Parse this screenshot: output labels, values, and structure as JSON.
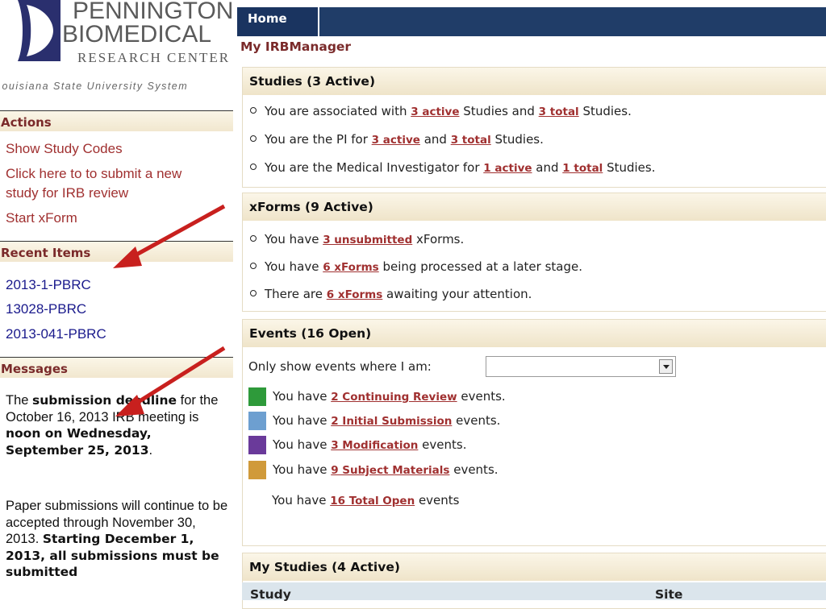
{
  "logo": {
    "line1": "PENNINGTON",
    "line2": "BIOMEDICAL",
    "line3": "RESEARCH CENTER",
    "line4": "Louisiana State University System"
  },
  "sidebar": {
    "actions_title": "Actions",
    "actions": [
      "Show Study Codes",
      "Click here to to submit a new",
      "study for IRB review",
      "Start xForm"
    ],
    "recent_title": "Recent Items",
    "recent": [
      "2013-1-PBRC",
      "13028-PBRC",
      "2013-041-PBRC"
    ],
    "messages_title": "Messages",
    "msg1": {
      "p1": "The ",
      "b1": "submission deadline",
      "p2": " for the October 16, 2013 IRB meeting is ",
      "b2": "noon on Wednesday, September 25, 2013",
      "p3": "."
    },
    "msg2": {
      "p1": "Paper submissions will continue to be accepted through November 30, 2013. ",
      "b1": "Starting December 1, 2013, all submissions must be submitted"
    }
  },
  "nav": {
    "home": "Home"
  },
  "subtitle": "My IRBManager",
  "studies": {
    "title": "Studies (3 Active)",
    "l1": {
      "a": "You are associated with ",
      "k1": "3 active",
      "b": " Studies and ",
      "k2": "3 total",
      "c": " Studies."
    },
    "l2": {
      "a": "You are the PI for ",
      "k1": "3 active",
      "b": " and ",
      "k2": "3 total",
      "c": " Studies."
    },
    "l3": {
      "a": "You are the Medical Investigator for ",
      "k1": "1 active",
      "b": " and ",
      "k2": "1 total",
      "c": " Studies."
    }
  },
  "xforms": {
    "title": "xForms (9 Active)",
    "l1": {
      "a": "You have ",
      "k": "3 unsubmitted",
      "b": " xForms."
    },
    "l2": {
      "a": "You have ",
      "k": "6 xForms",
      "b": " being processed at a later stage."
    },
    "l3": {
      "a": "There are ",
      "k": "6 xForms",
      "b": " awaiting your attention."
    }
  },
  "events": {
    "title": "Events (16 Open)",
    "filter_label": "Only show events where I am:",
    "filter_value": "",
    "rows": [
      {
        "a": "You have ",
        "k": "2 Continuing Review",
        "b": " events.",
        "color": "#2e9a3a"
      },
      {
        "a": "You have ",
        "k": "2 Initial Submission",
        "b": " events.",
        "color": "#6d9fd0"
      },
      {
        "a": "You have ",
        "k": "3 Modification",
        "b": " events.",
        "color": "#6a3a9a"
      },
      {
        "a": "You have ",
        "k": "9 Subject Materials",
        "b": " events.",
        "color": "#d09a3a"
      }
    ],
    "total": {
      "a": "You have ",
      "k": "16 Total Open",
      "b": " events"
    }
  },
  "my_studies": {
    "title": "My Studies (4 Active)",
    "columns": [
      "Study",
      "Site"
    ]
  }
}
